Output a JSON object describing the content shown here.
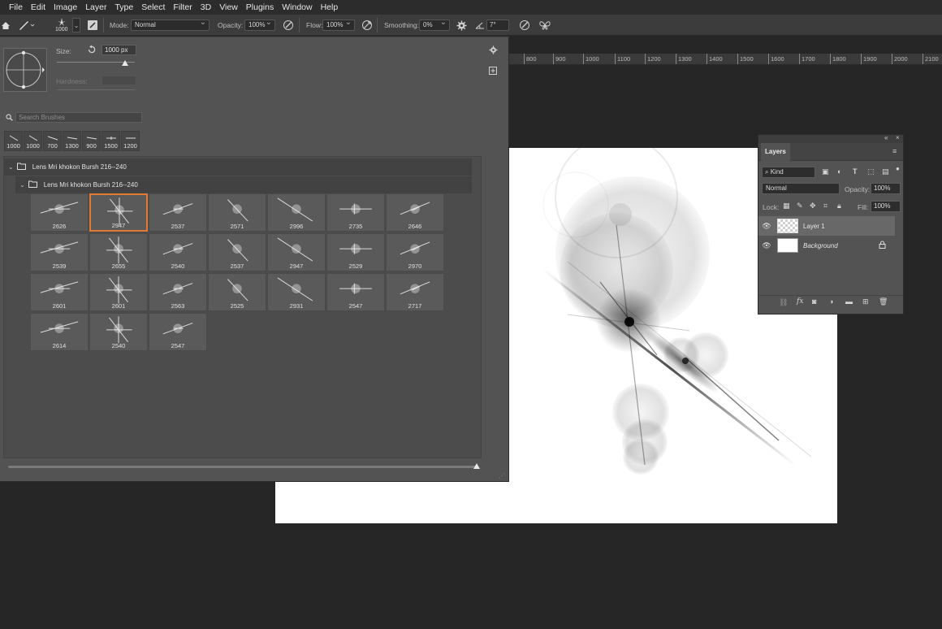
{
  "menu": [
    "File",
    "Edit",
    "Image",
    "Layer",
    "Type",
    "Select",
    "Filter",
    "3D",
    "View",
    "Plugins",
    "Window",
    "Help"
  ],
  "options_bar": {
    "brush_size_label": "1000",
    "mode_label": "Mode:",
    "mode_value": "Normal",
    "opacity_label": "Opacity:",
    "opacity_value": "100%",
    "flow_label": "Flow:",
    "flow_value": "100%",
    "smoothing_label": "Smoothing:",
    "smoothing_value": "0%",
    "angle_value": "7°"
  },
  "ruler_ticks": [
    "800",
    "900",
    "1000",
    "1100",
    "1200",
    "1300",
    "1400",
    "1500",
    "1600",
    "1700",
    "1800",
    "1900",
    "2000",
    "2100"
  ],
  "brush_panel": {
    "size_label": "Size:",
    "size_value": "1000 px",
    "size_fraction": 0.88,
    "hardness_label": "Hardness:",
    "search_placeholder": "Search Brushes",
    "recent_brushes": [
      "1000",
      "1000",
      "700",
      "1300",
      "900",
      "1500",
      "1200"
    ],
    "group_name": "Lens Mri khokon Bursh 216--240",
    "subgroup_name": "Lens Mri khokon Bursh 216--240",
    "brushes": [
      "2626",
      "2947",
      "2537",
      "2571",
      "2996",
      "2735",
      "2646",
      "2539",
      "2655",
      "2540",
      "2537",
      "2947",
      "2529",
      "2970",
      "2601",
      "2601",
      "2563",
      "2525",
      "2931",
      "2547",
      "2717",
      "2614",
      "2540",
      "2547"
    ],
    "selected_index": 1
  },
  "layers_panel": {
    "title": "Layers",
    "filter_label": "Kind",
    "blend_mode": "Normal",
    "opacity_label": "Opacity:",
    "opacity_value": "100%",
    "lock_label": "Lock:",
    "fill_label": "Fill:",
    "fill_value": "100%",
    "layers": [
      {
        "name": "Layer 1",
        "selected": true
      },
      {
        "name": "Background",
        "locked": true
      }
    ]
  },
  "icons": {
    "home": "home-icon",
    "brush_tool": "brush-icon",
    "settings": "gear-icon",
    "angle": "angle-icon",
    "pressure": "pressure-icon",
    "symmetry": "butterfly-icon",
    "search": "search-icon",
    "folder": "folder-icon",
    "eye": "eye-icon",
    "lock": "lock-icon"
  },
  "colors": {
    "selection_outline": "#e07a35",
    "canvas": "#ffffff",
    "workspace": "#262626"
  }
}
